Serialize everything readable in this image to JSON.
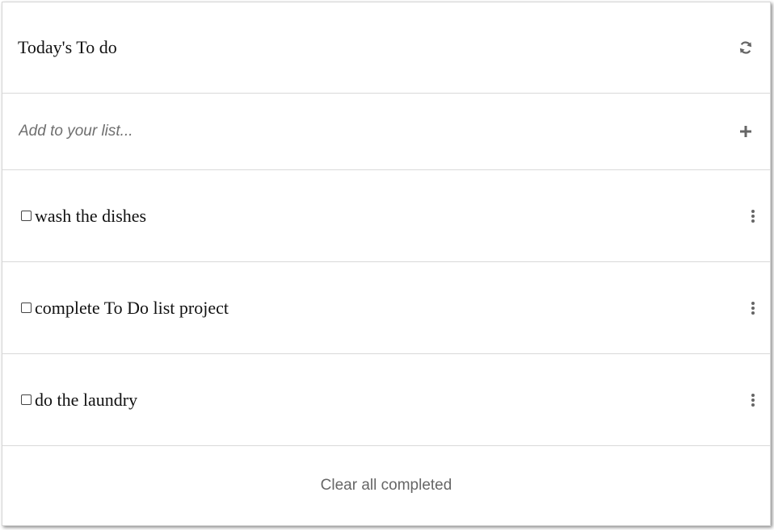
{
  "header": {
    "title": "Today's To do",
    "refresh_icon": "refresh-icon"
  },
  "add": {
    "placeholder": "Add to your list...",
    "value": "",
    "add_icon": "plus-icon"
  },
  "items": [
    {
      "label": "wash the dishes",
      "checked": false,
      "menu_icon": "kebab-menu-icon"
    },
    {
      "label": "complete To Do list project",
      "checked": false,
      "menu_icon": "kebab-menu-icon"
    },
    {
      "label": "do the laundry",
      "checked": false,
      "menu_icon": "kebab-menu-icon"
    }
  ],
  "footer": {
    "clear_label": "Clear all completed"
  },
  "colors": {
    "text": "#111111",
    "muted": "#666666",
    "divider": "#d9d9d9",
    "icon": "#666666"
  }
}
